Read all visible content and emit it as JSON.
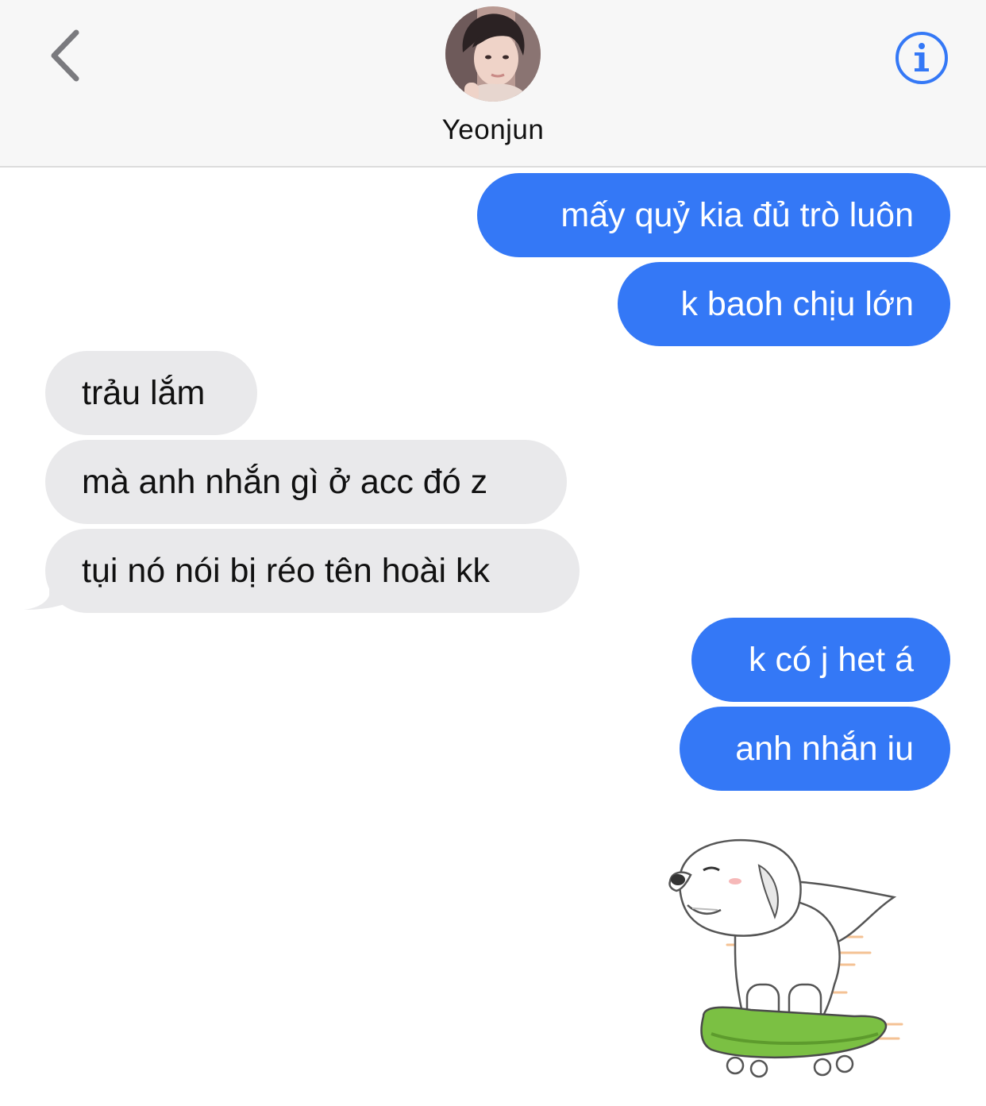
{
  "header": {
    "contact_name": "Yeonjun",
    "back_icon": "chevron-left-icon",
    "info_icon": "info-icon",
    "accent_color": "#3478f6"
  },
  "messages": [
    {
      "direction": "outgoing",
      "text": "mấy quỷ kia đủ trò luôn"
    },
    {
      "direction": "outgoing",
      "text": "k baoh chịu lớn"
    },
    {
      "direction": "incoming",
      "text": "trảu lắm"
    },
    {
      "direction": "incoming",
      "text": "mà anh nhắn gì ở acc đó z"
    },
    {
      "direction": "incoming",
      "text": "tụi nó nói bị réo tên hoài kk"
    },
    {
      "direction": "outgoing",
      "text": "k có j het á"
    },
    {
      "direction": "outgoing",
      "text": "anh nhắn iu"
    }
  ],
  "sticker": {
    "icon": "dog-on-skateboard-sticker"
  },
  "colors": {
    "outgoing_bubble": "#3478f6",
    "incoming_bubble": "#e9e9eb",
    "header_bg": "#f7f7f7"
  }
}
